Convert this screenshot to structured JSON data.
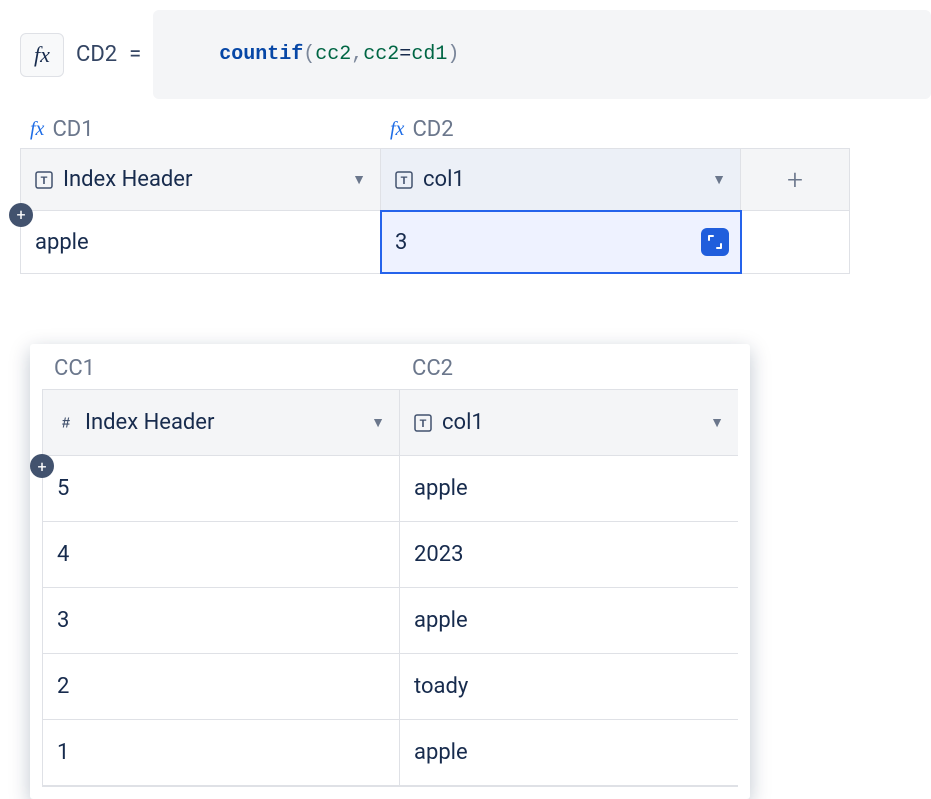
{
  "formula_bar": {
    "fx_label": "fx",
    "cell_ref": "CD2",
    "equals": "=",
    "formula": {
      "fn": "countif",
      "open": "(",
      "arg1": "cc2",
      "comma": ",",
      "arg2a": "cc2",
      "eq": "=",
      "arg2b": "cd1",
      "close": ")"
    }
  },
  "table1": {
    "col_labels": [
      {
        "fx": "fx",
        "id": "CD1"
      },
      {
        "fx": "fx",
        "id": "CD2"
      }
    ],
    "headers": {
      "col1": "Index Header",
      "col2": "col1"
    },
    "add_col": "+",
    "add_row": "+",
    "rows": [
      {
        "c1": "apple",
        "c2": "3"
      }
    ]
  },
  "table2": {
    "col_labels": [
      {
        "id": "CC1"
      },
      {
        "id": "CC2"
      }
    ],
    "headers": {
      "col1": "Index Header",
      "col2": "col1"
    },
    "add_row": "+",
    "rows": [
      {
        "c1": "5",
        "c2": "apple"
      },
      {
        "c1": "4",
        "c2": "2023"
      },
      {
        "c1": "3",
        "c2": "apple"
      },
      {
        "c1": "2",
        "c2": "toady"
      },
      {
        "c1": "1",
        "c2": "apple"
      }
    ]
  }
}
